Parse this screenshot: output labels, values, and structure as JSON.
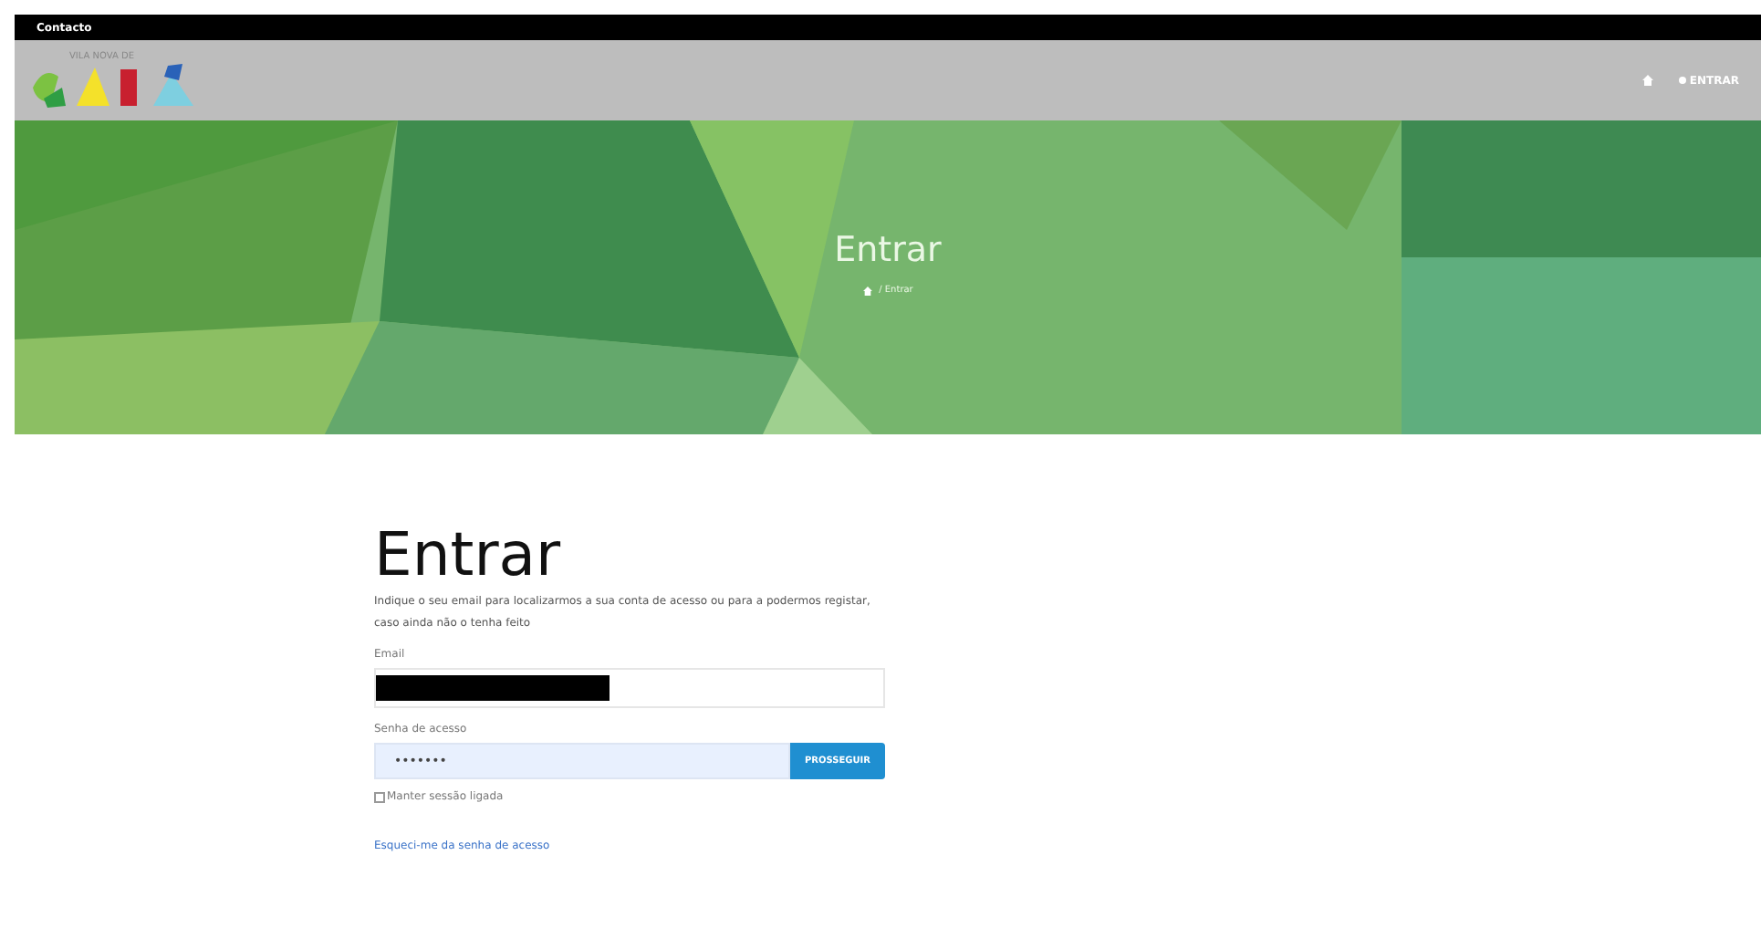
{
  "top_bar": {
    "link": "Contacto"
  },
  "header": {
    "logo_text": "VILA NOVA DE",
    "nav_login": "ENTRAR"
  },
  "hero": {
    "title": "Entrar",
    "breadcrumb": "/ Entrar"
  },
  "form": {
    "title": "Entrar",
    "intro": "Indique o seu email para localizarmos a sua conta de acesso ou para a podermos registar, caso ainda não o tenha feito",
    "email_label": "Email",
    "password_label": "Senha de acesso",
    "password_value": "•••••••",
    "submit": "PROSSEGUIR",
    "remember": {
      "label": "Manter sessão ligada",
      "checked": false
    },
    "forgot_link": "Esqueci-me da senha de acesso"
  }
}
